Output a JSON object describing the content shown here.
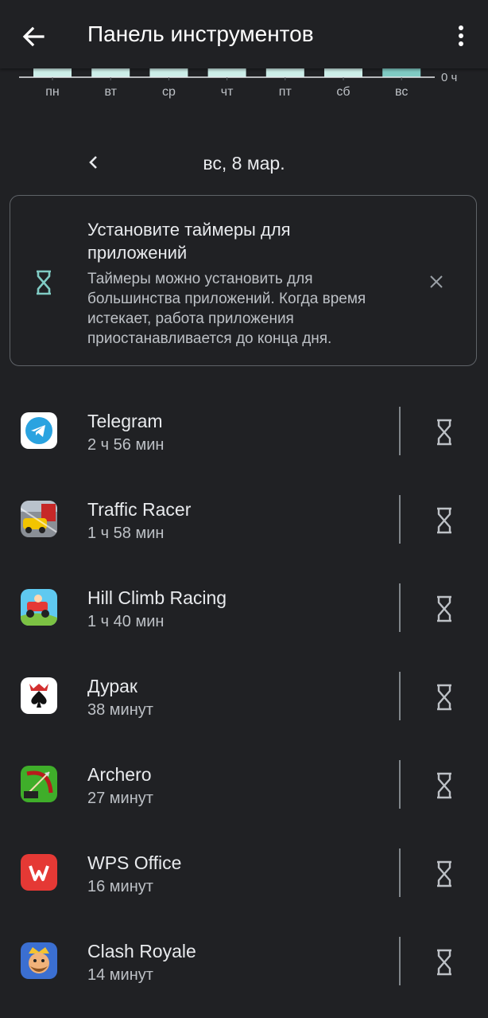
{
  "header": {
    "title": "Панель инструментов",
    "back_icon": "arrow-back-icon",
    "menu_icon": "more-vert-icon"
  },
  "chart_data": {
    "type": "bar",
    "categories": [
      "пн",
      "вт",
      "ср",
      "чт",
      "пт",
      "сб",
      "вс"
    ],
    "ytick_label": "0 ч",
    "selected_index": 6,
    "bar_color": "#cdeee9",
    "selected_color": "#80cbc4"
  },
  "date_nav": {
    "prev_icon": "chevron-left-icon",
    "date": "вс, 8 мар."
  },
  "timer_card": {
    "icon": "hourglass-icon",
    "title": "Установите таймеры для приложений",
    "body": "Таймеры можно установить для большинства приложений. Когда время истекает, работа приложения приостанавливается до конца дня.",
    "close_icon": "close-icon"
  },
  "apps": [
    {
      "name": "Telegram",
      "usage": "2 ч 56 мин",
      "icon": "telegram-icon"
    },
    {
      "name": "Traffic Racer",
      "usage": "1 ч 58 мин",
      "icon": "traffic-racer-icon"
    },
    {
      "name": "Hill Climb Racing",
      "usage": "1 ч 40 мин",
      "icon": "hill-climb-racing-icon"
    },
    {
      "name": "Дурак",
      "usage": "38 минут",
      "icon": "durak-icon"
    },
    {
      "name": "Archero",
      "usage": "27 минут",
      "icon": "archero-icon"
    },
    {
      "name": "WPS Office",
      "usage": "16 минут",
      "icon": "wps-office-icon"
    },
    {
      "name": "Clash Royale",
      "usage": "14 минут",
      "icon": "clash-royale-icon"
    }
  ],
  "colors": {
    "background": "#202124",
    "accent": "#80cbc4"
  }
}
